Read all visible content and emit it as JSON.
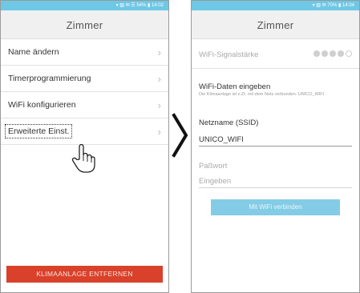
{
  "left_screen": {
    "status": "▾ ▧ ✉ ☰ 54% ▮ 14:02",
    "title": "Zimmer",
    "menu": [
      {
        "label": "Name ändern"
      },
      {
        "label": "Timerprogrammierung"
      },
      {
        "label": "WiFi konfigurieren"
      },
      {
        "label": "Erweiterte Einst."
      }
    ],
    "chevron": "›",
    "remove_button": "KLIMAANLAGE ENTFERNEN"
  },
  "right_screen": {
    "status": "▾ ▧ ✉ 70% ▮ 14:04",
    "title": "Zimmer",
    "signal_label": "WiFi-Signalstärke",
    "signal_strength": {
      "filled": 4,
      "total": 5
    },
    "wifi_heading": "WiFi-Daten eingeben",
    "wifi_subtext": "Die Klimaanlage ist z.Zt. mit dem Netz verbunden: UNICO_WIFI",
    "ssid_label": "Netzname (SSID)",
    "ssid_value": "UNICO_WIFI",
    "password_label": "Paßwort",
    "password_placeholder": "Eingeben",
    "connect_button": "Mit WiFi verbinden"
  },
  "icons": {
    "hand": "pointing-hand-icon",
    "arrow": "chevron-right-icon"
  },
  "colors": {
    "statusbar": "#6ec8e6",
    "remove_button": "#d9412b",
    "connect_button": "#84cce6"
  }
}
